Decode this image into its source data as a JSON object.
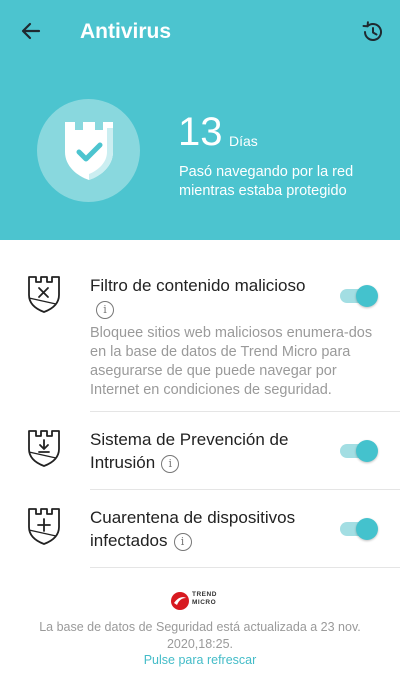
{
  "header": {
    "title": "Antivirus",
    "days_count": "13",
    "days_unit": "Días",
    "subtitle": "Pasó navegando por la red mientras estaba protegido"
  },
  "items": [
    {
      "title": "Filtro de contenido malicioso",
      "description": "Bloquee sitios web maliciosos enumera-dos en la base de datos de Trend Micro para asegurarse de que puede navegar por Internet en condiciones de seguridad.",
      "enabled": true,
      "icon": "shield-x-icon"
    },
    {
      "title": "Sistema de Prevención de Intrusión",
      "enabled": true,
      "icon": "shield-download-icon"
    },
    {
      "title": "Cuarentena de dispositivos infectados",
      "enabled": true,
      "icon": "shield-plus-icon"
    }
  ],
  "footer": {
    "logo_line1": "TREND",
    "logo_line2": "MICRO",
    "db_status": "La base de datos de Seguridad está actualizada a 23 nov. 2020,18:25.",
    "refresh_label": "Pulse para refrescar"
  },
  "colors": {
    "header_bg": "#4cc4cf",
    "accent": "#44c2cd",
    "logo_red": "#d71920"
  }
}
